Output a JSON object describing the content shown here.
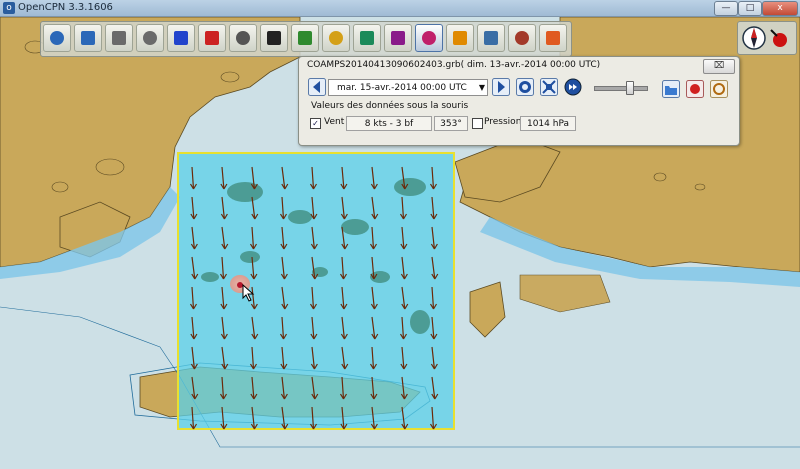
{
  "window": {
    "title": "OpenCPN 3.3.1606",
    "minimize": "—",
    "maximize": "□",
    "close": "x",
    "icon_glyph": "o"
  },
  "toolbar": {
    "tools": [
      {
        "name": "zoom-in-icon",
        "color": "#2b68b8"
      },
      {
        "name": "zoom-out-icon",
        "color": "#2b68b8"
      },
      {
        "name": "scale-in-icon",
        "color": "#6a6a6a"
      },
      {
        "name": "scale-out-icon",
        "color": "#6a6a6a"
      },
      {
        "name": "route-icon",
        "color": "#2244cc"
      },
      {
        "name": "ship-icon",
        "color": "#cc2222"
      },
      {
        "name": "settings-icon",
        "color": "#555555"
      },
      {
        "name": "text-icon",
        "color": "#222222"
      },
      {
        "name": "track-icon",
        "color": "#2f8a2f"
      },
      {
        "name": "chart-quilt-icon",
        "color": "#d4a017"
      },
      {
        "name": "tides-icon",
        "color": "#1b8a5a"
      },
      {
        "name": "route-manager-icon",
        "color": "#8a1b8a"
      },
      {
        "name": "grib-icon",
        "color": "#c01f6a"
      },
      {
        "name": "dashboard-icon",
        "color": "#e08a00"
      },
      {
        "name": "ais-icon",
        "color": "#3a6ea5"
      },
      {
        "name": "alarm-icon",
        "color": "#a33a2a"
      },
      {
        "name": "lifebuoy-icon",
        "color": "#e05a20"
      }
    ]
  },
  "grib": {
    "title": "COAMPS20140413090602403.grb( dim. 13-avr.-2014 00:00  UTC)",
    "close": "⌧",
    "time": "mar. 15-avr.-2014 00:00  UTC",
    "time_arrow": "▼",
    "group_label": "Valeurs des données sous la souris",
    "wind_label": "Vent",
    "wind_checked": "✓",
    "wind_speed": "8 kts -  3 bf",
    "wind_dir": "353°",
    "pressure_label": "Pression",
    "pressure_value": "1014 hPa"
  },
  "colors": {
    "land": "#c9a85a",
    "sea": "#cde0e6",
    "shallow": "#7ec6e8",
    "grib_overlay": "#5ad0e8",
    "frame": "#e8e030",
    "arrow": "#6b2a0a"
  }
}
